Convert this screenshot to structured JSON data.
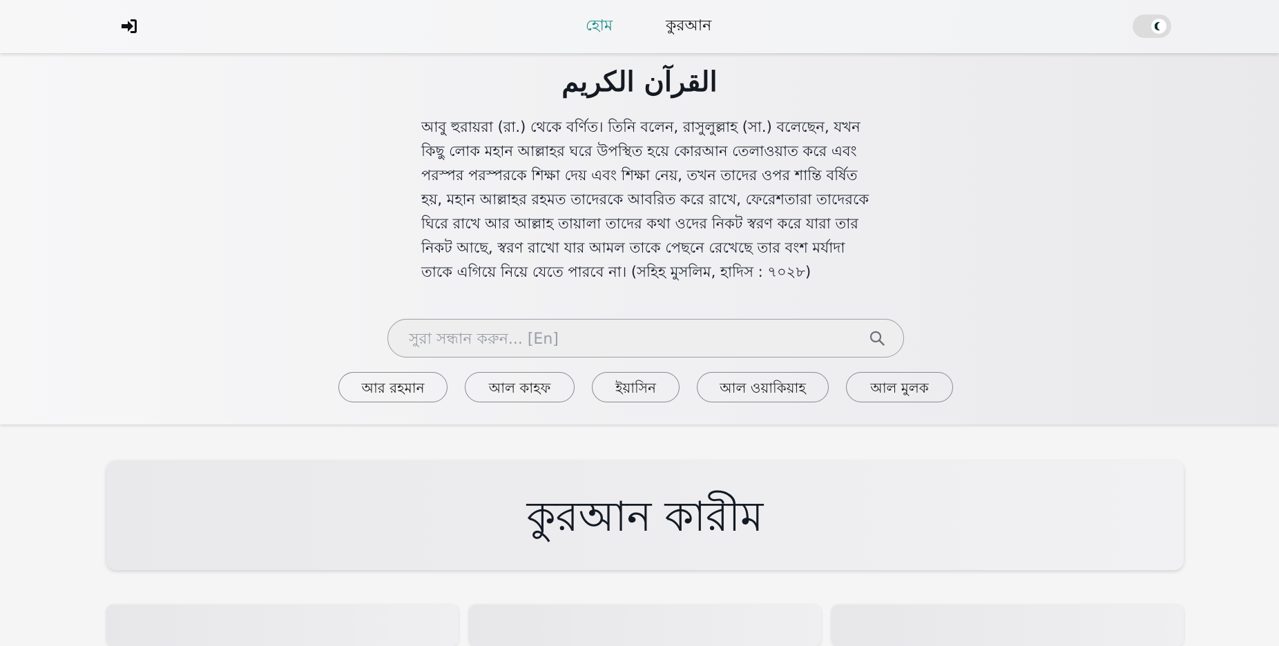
{
  "header": {
    "login_icon": "sign-in-icon",
    "nav": [
      {
        "label": "হোম",
        "active": true
      },
      {
        "label": "কুরআন",
        "active": false
      }
    ],
    "theme_toggle_icon": "moon-icon"
  },
  "hero": {
    "arabic_title": "القرآن الكريم",
    "hadith": "আবু হুরায়রা (রা.) থেকে বর্ণিত। তিনি বলেন, রাসুলুল্লাহ (সা.) বলেছেন, যখন কিছু লোক মহান আল্লাহর ঘরে উপস্থিত হয়ে কোরআন তেলাওয়াত করে এবং পরস্পর পরস্পরকে শিক্ষা দেয় এবং শিক্ষা নেয়, তখন তাদের ওপর শান্তি বর্ষিত হয়, মহান আল্লাহর রহমত তাদেরকে আবরিত করে রাখে, ফেরেশতারা তাদেরকে ঘিরে রাখে আর আল্লাহ তায়ালা তাদের কথা ওদের নিকট স্বরণ করে যারা তার নিকট আছে, স্বরণ রাখো যার আমল তাকে পেছনে রেখেছে তার বংশ মর্যাদা তাকে এগিয়ে নিয়ে যেতে পারবে না। (সহিহ মুসলিম, হাদিস : ৭০২৮)",
    "search": {
      "placeholder": "সুরা সন্ধান করুন... [En]",
      "value": "",
      "icon": "search-icon"
    },
    "chips": [
      "আর রহমান",
      "আল কাহফ",
      "ইয়াসিন",
      "আল ওয়াকিয়াহ",
      "আল মুলক"
    ]
  },
  "main": {
    "title": "কুরআন কারীম"
  },
  "colors": {
    "accent": "#1a8f8a",
    "text": "#1f2430",
    "background": "#f5f5f6"
  }
}
